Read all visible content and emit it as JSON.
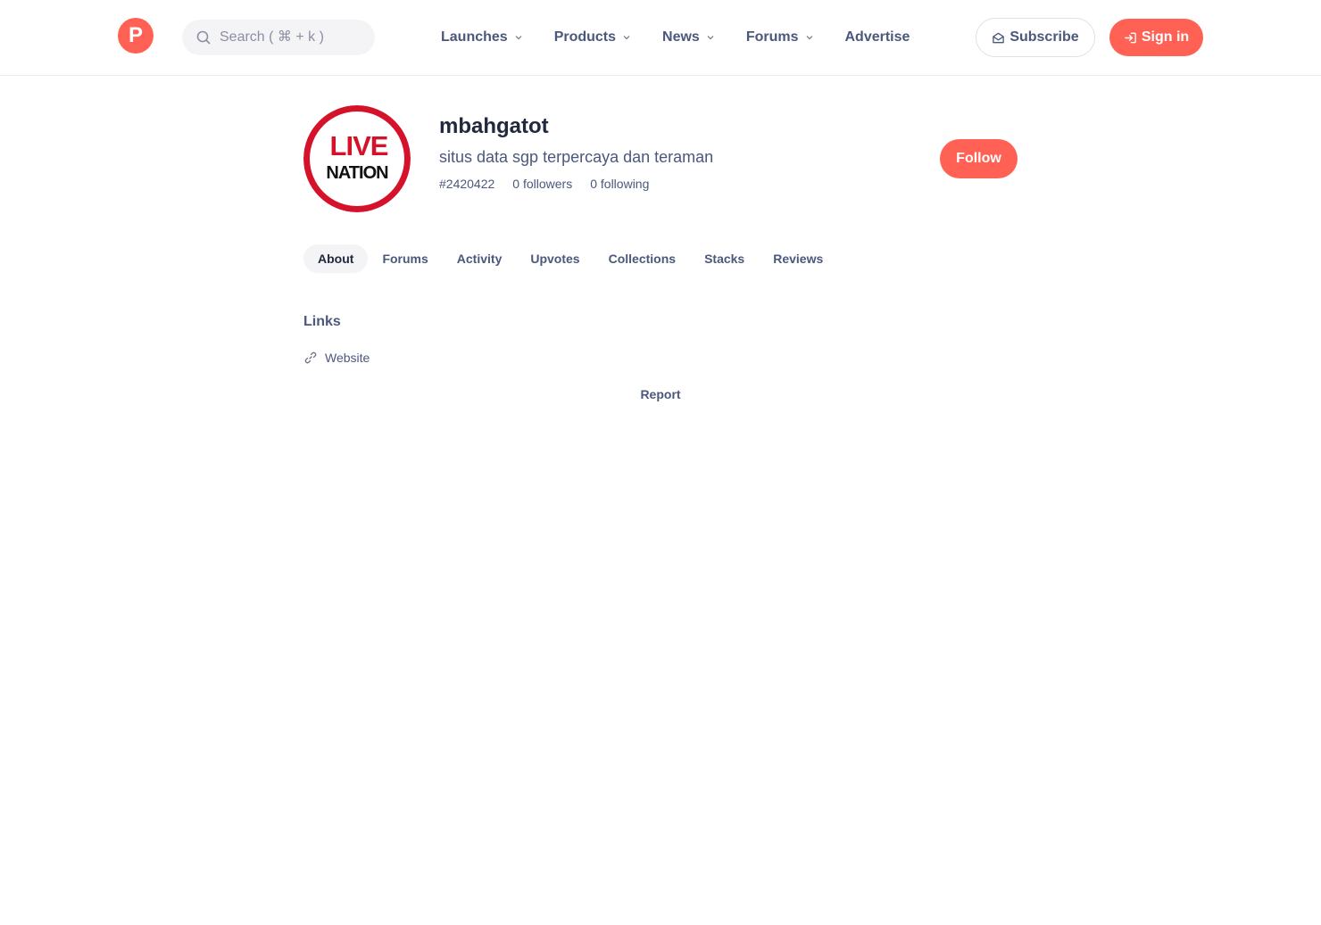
{
  "header": {
    "logo_letter": "P",
    "search_placeholder": "Search ( ⌘ + k )",
    "nav": [
      {
        "label": "Launches",
        "has_dropdown": true
      },
      {
        "label": "Products",
        "has_dropdown": true
      },
      {
        "label": "News",
        "has_dropdown": true
      },
      {
        "label": "Forums",
        "has_dropdown": true
      },
      {
        "label": "Advertise",
        "has_dropdown": false
      }
    ],
    "subscribe_label": "Subscribe",
    "signin_label": "Sign in"
  },
  "profile": {
    "avatar_text_top": "LIVE",
    "avatar_text_bottom": "NATION",
    "username": "mbahgatot",
    "headline": "situs data sgp terpercaya dan teraman",
    "user_id": "#2420422",
    "followers": "0 followers",
    "following": "0 following",
    "follow_label": "Follow"
  },
  "tabs": [
    {
      "label": "About",
      "active": true
    },
    {
      "label": "Forums",
      "active": false
    },
    {
      "label": "Activity",
      "active": false
    },
    {
      "label": "Upvotes",
      "active": false
    },
    {
      "label": "Collections",
      "active": false
    },
    {
      "label": "Stacks",
      "active": false
    },
    {
      "label": "Reviews",
      "active": false
    }
  ],
  "about": {
    "links_title": "Links",
    "links": [
      {
        "label": "Website",
        "icon": "link-icon"
      }
    ],
    "report_label": "Report"
  },
  "colors": {
    "brand": "#ff6154",
    "text_primary": "#21293c",
    "text_secondary": "#4b587c",
    "avatar_ring": "#d6122a"
  }
}
